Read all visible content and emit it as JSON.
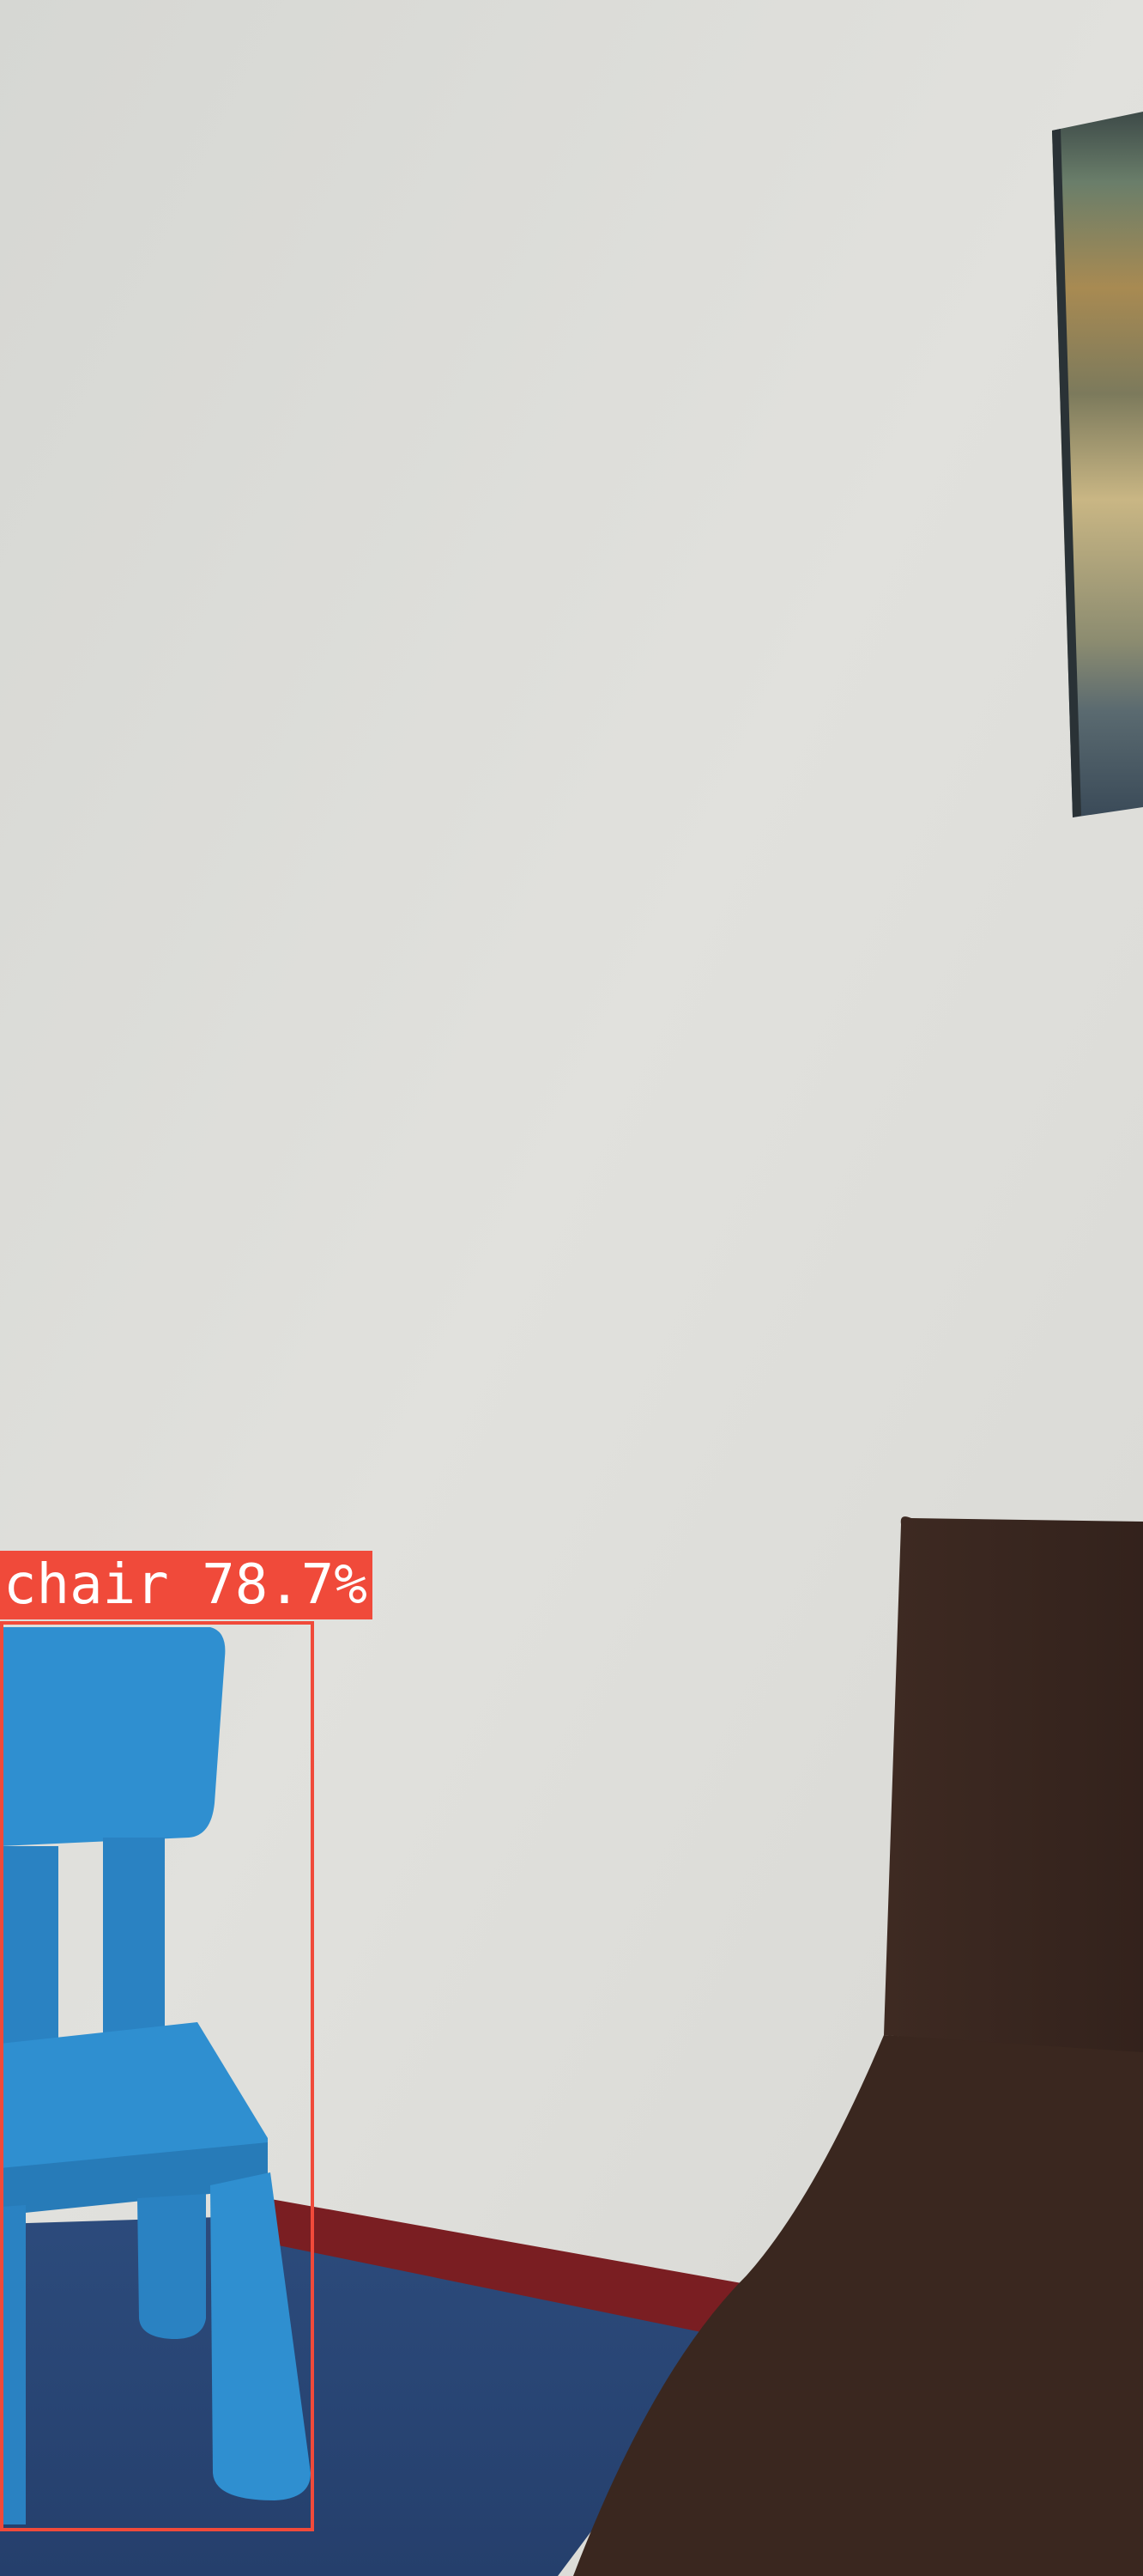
{
  "detections": [
    {
      "label": "chair 78.7%",
      "class": "chair",
      "confidence_percent": 78.7,
      "box_color": "#f04a3a"
    }
  ],
  "colors": {
    "wall": "#dcdcd8",
    "floor": "#2a4a7a",
    "baseboard": "#7a1e22",
    "chair": "#2f8fd0",
    "sofa": "#3a2620"
  }
}
